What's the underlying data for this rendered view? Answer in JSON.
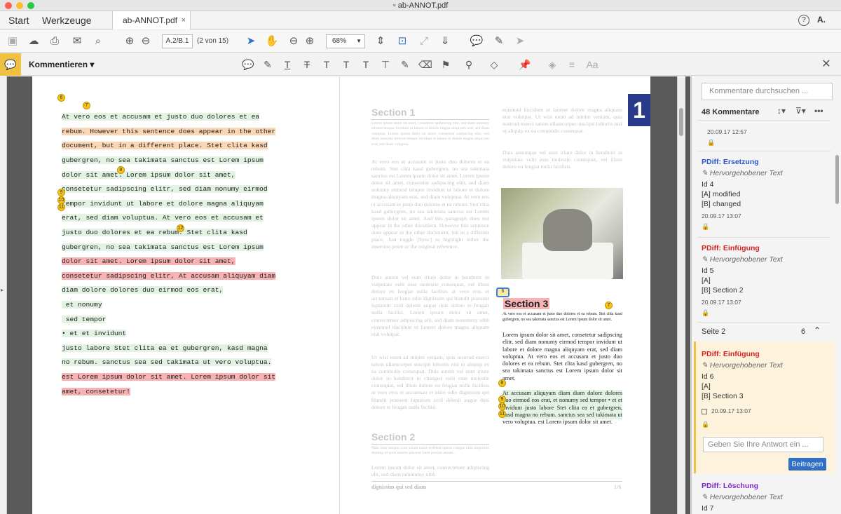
{
  "window": {
    "title": "ab-ANNOT.pdf"
  },
  "tabs": {
    "start": "Start",
    "tools": "Werkzeuge",
    "document": "ab-ANNOT.pdf",
    "close": "×"
  },
  "toolbar": {
    "page_box": "A.2/B.1",
    "page_count": "(2 von 15)",
    "zoom": "68%"
  },
  "comment_bar": {
    "label": "Kommentieren ▾"
  },
  "left_page": {
    "lines": [
      "At vero eos et accusam et justo duo dolores et ea",
      "rebum. However this sentence does appear in the other",
      "document, but in a different place. Stet clita kasd",
      "gubergren, no sea takimata sanctus est Lorem ipsum",
      "dolor sit amet. Lorem ipsum dolor sit amet,",
      "consetetur sadipscing elitr, sed diam nonumy eirmod",
      "tempor invidunt ut labore et dolore magna aliquyam",
      "erat, sed diam voluptua. At vero eos et accusam et",
      "justo duo dolores et ea rebum. Stet clita kasd",
      "gubergren, no sea takimata sanctus est Lorem ipsum",
      "dolor sit amet. Lorem ipsum dolor sit amet,",
      "consetetur sadipscing elitr, At accusam aliquyam diam",
      "diam dolore dolores duo eirmod eos erat,",
      " et nonumy",
      " sed tempor",
      "• et et invidunt",
      "justo labore Stet clita ea et gubergren, kasd magna",
      "no rebum. sanctus sea sed takimata ut vero voluptua.",
      "est Lorem ipsum dolor sit amet. Lorem ipsum dolor sit",
      "amet, consetetur!"
    ],
    "markers": [
      "6",
      "7",
      "8",
      "9",
      "10",
      "11",
      "12"
    ]
  },
  "right_page": {
    "section1": "Section 1",
    "section2": "Section 2",
    "section3": "Section 3",
    "page_badge": "1",
    "col1_small": "Lorem ipsum dolor sit amet, consetetur sadipscing elitr, sed diam nonumy eirmod tempor invidunt ut labore et dolore magna aliquyam erat, sed diam voluptua. Lorem ipsum dolor sit amet, consetetur sadipscing elitr, sed diam nonumy eirmod tempor invidunt ut labore et dolore magna aliquyam erat, sed diam voluptua.",
    "col1_p1": "At vero eos et accusam et justo duo dolores et ea rebum. Stet clita kasd gubergren, no sea takimata sanctus est Lorem ipsum dolor sit amet. Lorem ipsum dolor sit amet, consetetur sadipscing elitr, sed diam nonumy eirmod tempor invidunt ut labore et dolore magna aliquyam erat, sed diam voluptua. At vero eos et accusam et justo duo dolores et ea rebum. Stet clita kasd gubergren, no sea takimata sanctus est Lorem ipsum dolor sit amet. And this paragraph does not appear in the other document. However this sentence does appear in the other document, but in a different place. Just toggle [Sync] to highlight either the insertion point or the original reference.",
    "col1_p2": "Duis autem vel eum iriure dolor in hendrerit in vulputate velit esse molestie consequat, vel illum dolore eu feugiat nulla facilisis at vero eros et accumsan et iusto odio dignissim qui blandit praesent luptatum zzril delenit augue duis dolore te feugait nulla facilisi. Lorem ipsum dolor sit amet, consectetuer adipiscing elit, sed diam nonummy nibh euismod tincidunt ut laoreet dolore magna aliquam erat volutpat.",
    "col1_p3": "Ut wisi enim ad minim veniam, quis nostrud exerci tation ullamcorper suscipit lobortis nisl ut aliquip ex ea commodo consequat. Duis autem vel eum iriure dolor in hendrerit in changed velit esse molestie consequat, vel illum dolore eu feugiat nulla facilisis at vero eros et accumsan et iusto odio dignissim qui blandit praesent luptatum zzril delenit augue duis dolore te feugait nulla facilisi.",
    "col1_small2": "Nam liber tempor cum soluta nobis eleifend option congue nihil imperdiet doming id quod mazim placerat facer possim assum.",
    "col1_p4": "Lorem ipsum dolor sit amet, consectetuer adipiscing elit, sed diam nonummy nibh",
    "col2_p1": "euismod tincidunt ut laoreet dolore magna aliquam erat volutpat. Ut wisi enim ad minim veniam, quis nostrud exerci tation ullamcorper suscipit lobortis nisl ut aliquip ex ea commodo consequat.",
    "col2_p2": "Duis autemque vel eum iriure dolor in hendrerit in vulputate velit esse molestie consequat, vel illum dolore eu feugiat nulla facilisis.",
    "col2_small": "At vero eos et accusam et justo duo dolores et ea rebum. Stet clita kasd gubergren, no sea takimata sanctus est Lorem ipsum dolor sit amet.",
    "col2_p3": "Lorem ipsum dolor sit amet, consetetur sadipscing elitr, sed diam nonumy eirmod tempor invidunt ut labore et dolore magna aliquyam erat, sed diam voluptua. At vero eos et accusam et justo duo dolores et ea rebum. Stet clita kasd gubergren, no sea takimata sanctus est Lorem ipsum dolor sit amet.",
    "col2_p4": "At accusam aliquyam diam diam dolore dolores duo eirmod eos erat, et nonumy sed tempor • et et invidunt justo labore Stet clita ea et gubergren, kasd magna no rebum. sanctus sea sed takimata ut vero voluptua. est Lorem ipsum dolor sit amet.",
    "footer": "dignissim qui sed diam",
    "footer_page": "1/6",
    "markers": [
      "6",
      "7",
      "8",
      "9",
      "10",
      "11"
    ]
  },
  "panel": {
    "search_placeholder": "Kommentare durchsuchen ...",
    "count": "48 Kommentare",
    "top_date": "20.09.17  12:57",
    "cards": [
      {
        "title": "PDiff: Ersetzung",
        "kind": "Hervorgehobener Text",
        "id": "Id 4",
        "a": "[A] modified",
        "b": "[B] changed",
        "date": "20.09.17  13:07",
        "color": "#2a55c8"
      },
      {
        "title": "PDiff: Einfügung",
        "kind": "Hervorgehobener Text",
        "id": "Id 5",
        "a": "[A]",
        "b": "[B] Section 2",
        "date": "20.09.17  13:07",
        "color": "#d62020"
      }
    ],
    "seite": "Seite 2",
    "seite_count": "6",
    "active": {
      "title": "PDiff: Einfügung",
      "kind": "Hervorgehobener Text",
      "id": "Id 6",
      "a": "[A]",
      "b": "[B] Section 3",
      "date": "20.09.17  13:07",
      "reply_placeholder": "Geben Sie Ihre Antwort ein ...",
      "button": "Beitragen"
    },
    "last": {
      "title": "PDiff: Löschung",
      "kind": "Hervorgehobener Text",
      "id": "Id 7"
    }
  },
  "colors": {
    "accent": "#f0c040",
    "blue": "#2f6fc6",
    "insert": "#d62020",
    "replace": "#2a55c8",
    "delete": "#7a2ac8"
  }
}
